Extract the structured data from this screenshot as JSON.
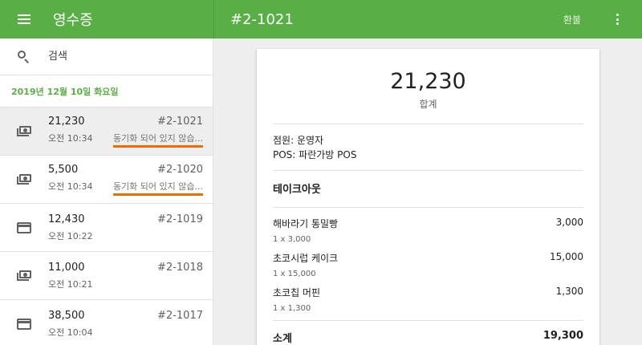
{
  "header": {
    "app_title": "영수증",
    "receipt_id": "#2-1021",
    "refund_label": "환불"
  },
  "sidebar": {
    "search_placeholder": "검색",
    "date": "2019년 12월 10일 화요일",
    "items": [
      {
        "amount": "21,230",
        "number": "#2-1021",
        "time": "오전 10:34",
        "status": "동기화 되어 있지 않습...",
        "icon": "cash-icon"
      },
      {
        "amount": "5,500",
        "number": "#2-1020",
        "time": "오전 10:34",
        "status": "동기화 되어 있지 않습...",
        "icon": "cash-icon"
      },
      {
        "amount": "12,430",
        "number": "#2-1019",
        "time": "오전 10:22",
        "icon": "card-icon"
      },
      {
        "amount": "11,000",
        "number": "#2-1018",
        "time": "오전 10:21",
        "icon": "cash-icon"
      },
      {
        "amount": "38,500",
        "number": "#2-1017",
        "time": "오전 10:04",
        "icon": "card-icon"
      }
    ]
  },
  "receipt": {
    "total": "21,230",
    "total_label": "합계",
    "employee": "점원: 운영자",
    "pos": "POS: 파란가방 POS",
    "dining_option": "테이크아웃",
    "lines": [
      {
        "name": "해바라기 통밀빵",
        "price": "3,000",
        "detail": "1 x 3,000"
      },
      {
        "name": "초코시럽 케이크",
        "price": "15,000",
        "detail": "1 x 15,000"
      },
      {
        "name": "초코칩 머핀",
        "price": "1,300",
        "detail": "1 x 1,300"
      }
    ],
    "subtotal_label": "소계",
    "subtotal": "19,300"
  },
  "colors": {
    "brand": "#5aae46",
    "warning_underline": "#ef6c00"
  }
}
